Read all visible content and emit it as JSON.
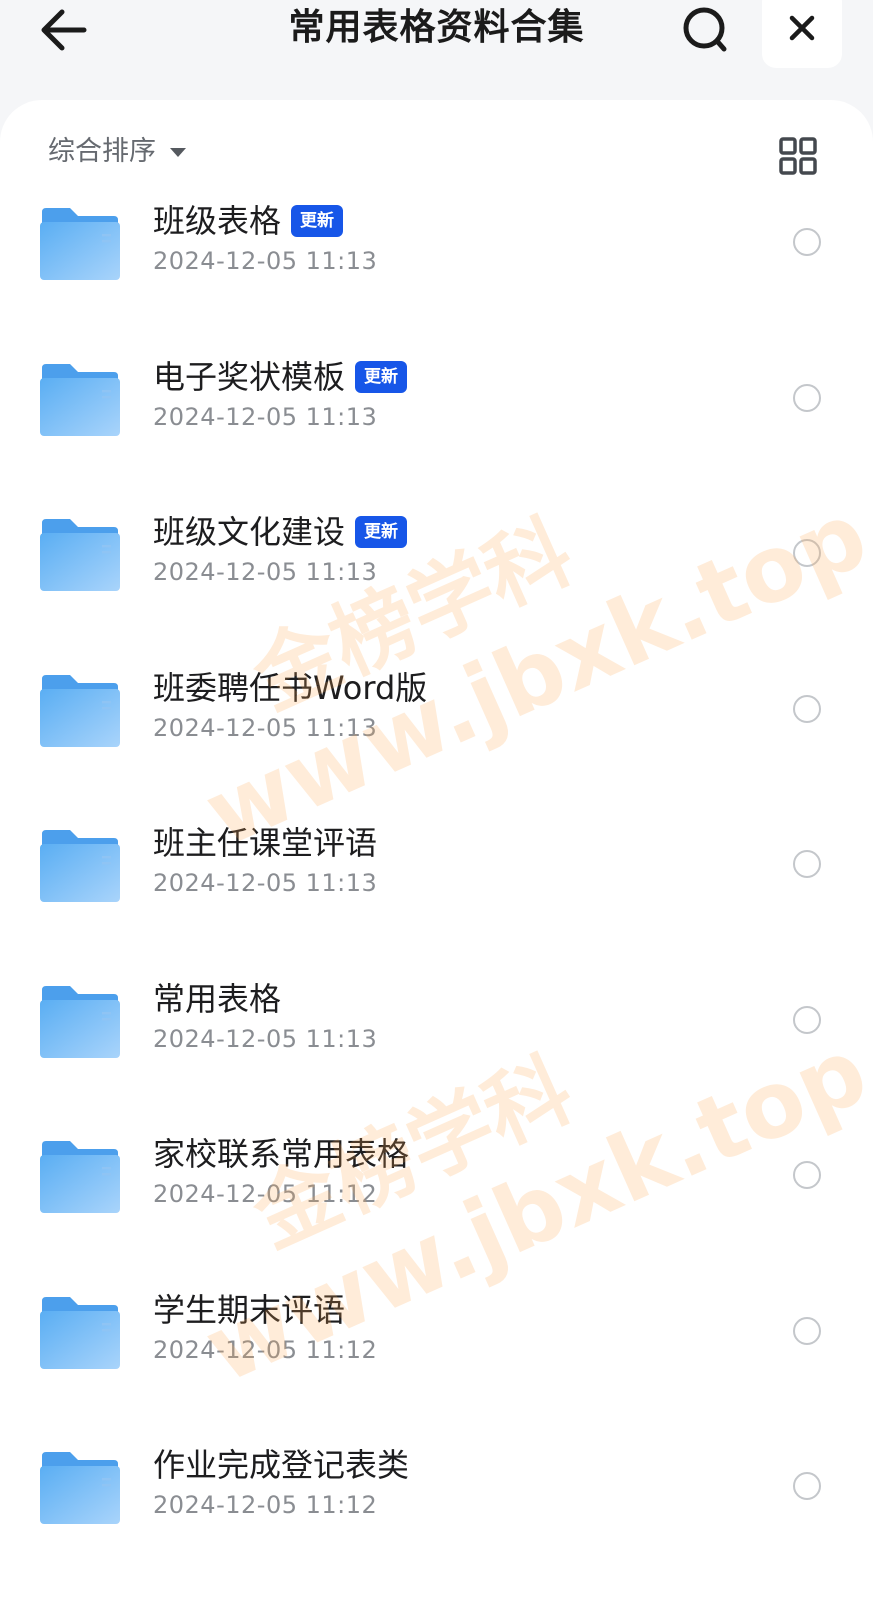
{
  "header": {
    "title": "常用表格资料合集",
    "back_icon": "arrow-left-icon",
    "search_icon": "search-icon",
    "close_icon": "close-icon"
  },
  "toolbar": {
    "sort_label": "综合排序",
    "view_toggle_icon": "grid-view-icon"
  },
  "files": [
    {
      "name": "班级表格",
      "date": "2024-12-05 11:13",
      "badge": "更新"
    },
    {
      "name": "电子奖状模板",
      "date": "2024-12-05 11:13",
      "badge": "更新"
    },
    {
      "name": "班级文化建设",
      "date": "2024-12-05 11:13",
      "badge": "更新"
    },
    {
      "name": "班委聘任书Word版",
      "date": "2024-12-05 11:13",
      "badge": ""
    },
    {
      "name": "班主任课堂评语",
      "date": "2024-12-05 11:13",
      "badge": ""
    },
    {
      "name": "常用表格",
      "date": "2024-12-05 11:13",
      "badge": ""
    },
    {
      "name": "家校联系常用表格",
      "date": "2024-12-05 11:12",
      "badge": ""
    },
    {
      "name": "学生期末评语",
      "date": "2024-12-05 11:12",
      "badge": ""
    },
    {
      "name": "作业完成登记表类",
      "date": "2024-12-05 11:12",
      "badge": ""
    }
  ],
  "watermark": {
    "line1": "金榜学科",
    "line2": "www.jbxk.top"
  },
  "colors": {
    "accent_badge": "#1756e8",
    "folder": "#6bb8f5",
    "watermark": "#ffaa50"
  }
}
